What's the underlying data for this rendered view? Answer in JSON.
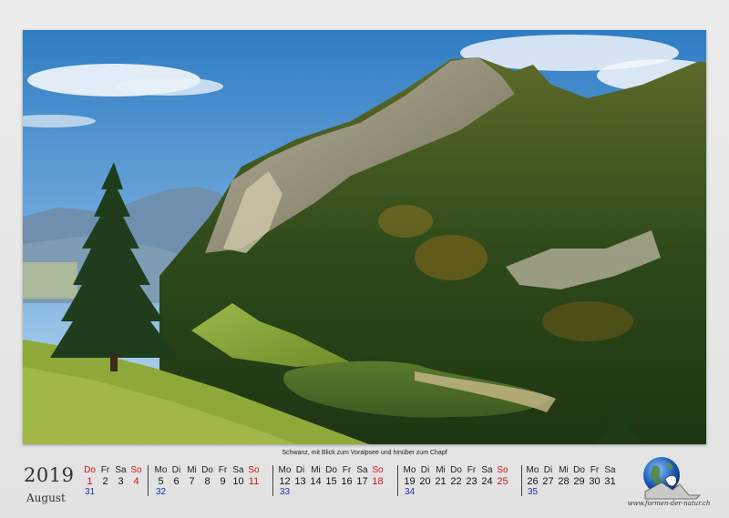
{
  "caption": "Schwanz, mit Blick zum Voralpsee und hinüber zum Chapf",
  "year": "2019",
  "month": "August",
  "website": "www.formen-der-natur.ch",
  "colors": {
    "weekend": "#d3141b",
    "week_number": "#1b2fb8"
  },
  "weeks": [
    {
      "number": "31",
      "days": [
        {
          "name": "Do",
          "date": "1",
          "weekend": true
        },
        {
          "name": "Fr",
          "date": "2",
          "weekend": false
        },
        {
          "name": "Sa",
          "date": "3",
          "weekend": false
        },
        {
          "name": "So",
          "date": "4",
          "weekend": true
        }
      ]
    },
    {
      "number": "32",
      "days": [
        {
          "name": "Mo",
          "date": "5",
          "weekend": false
        },
        {
          "name": "Di",
          "date": "6",
          "weekend": false
        },
        {
          "name": "Mi",
          "date": "7",
          "weekend": false
        },
        {
          "name": "Do",
          "date": "8",
          "weekend": false
        },
        {
          "name": "Fr",
          "date": "9",
          "weekend": false
        },
        {
          "name": "Sa",
          "date": "10",
          "weekend": false
        },
        {
          "name": "So",
          "date": "11",
          "weekend": true
        }
      ]
    },
    {
      "number": "33",
      "days": [
        {
          "name": "Mo",
          "date": "12",
          "weekend": false
        },
        {
          "name": "Di",
          "date": "13",
          "weekend": false
        },
        {
          "name": "Mi",
          "date": "14",
          "weekend": false
        },
        {
          "name": "Do",
          "date": "15",
          "weekend": false
        },
        {
          "name": "Fr",
          "date": "16",
          "weekend": false
        },
        {
          "name": "Sa",
          "date": "17",
          "weekend": false
        },
        {
          "name": "So",
          "date": "18",
          "weekend": true
        }
      ]
    },
    {
      "number": "34",
      "days": [
        {
          "name": "Mo",
          "date": "19",
          "weekend": false
        },
        {
          "name": "Di",
          "date": "20",
          "weekend": false
        },
        {
          "name": "Mi",
          "date": "21",
          "weekend": false
        },
        {
          "name": "Do",
          "date": "22",
          "weekend": false
        },
        {
          "name": "Fr",
          "date": "23",
          "weekend": false
        },
        {
          "name": "Sa",
          "date": "24",
          "weekend": false
        },
        {
          "name": "So",
          "date": "25",
          "weekend": true
        }
      ]
    },
    {
      "number": "35",
      "days": [
        {
          "name": "Mo",
          "date": "26",
          "weekend": false
        },
        {
          "name": "Di",
          "date": "27",
          "weekend": false
        },
        {
          "name": "Mi",
          "date": "28",
          "weekend": false
        },
        {
          "name": "Do",
          "date": "29",
          "weekend": false
        },
        {
          "name": "Fr",
          "date": "30",
          "weekend": false
        },
        {
          "name": "Sa",
          "date": "31",
          "weekend": false
        }
      ]
    }
  ]
}
